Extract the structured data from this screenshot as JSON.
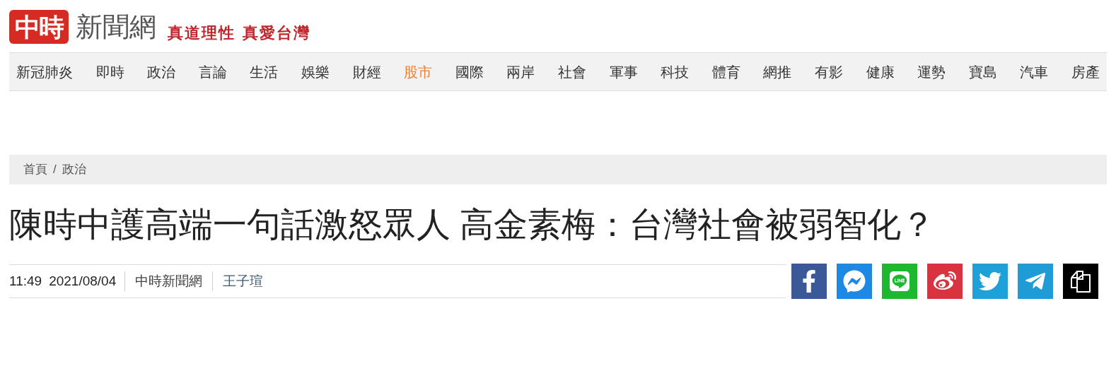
{
  "header": {
    "logo_mark": "中時",
    "logo_text": "新聞網",
    "slogan": "真道理性 真愛台灣"
  },
  "nav": [
    {
      "label": "新冠肺炎",
      "selected": false
    },
    {
      "label": "即時",
      "selected": false
    },
    {
      "label": "政治",
      "selected": false
    },
    {
      "label": "言論",
      "selected": false
    },
    {
      "label": "生活",
      "selected": false
    },
    {
      "label": "娛樂",
      "selected": false
    },
    {
      "label": "財經",
      "selected": false
    },
    {
      "label": "股市",
      "selected": true
    },
    {
      "label": "國際",
      "selected": false
    },
    {
      "label": "兩岸",
      "selected": false
    },
    {
      "label": "社會",
      "selected": false
    },
    {
      "label": "軍事",
      "selected": false
    },
    {
      "label": "科技",
      "selected": false
    },
    {
      "label": "體育",
      "selected": false
    },
    {
      "label": "網推",
      "selected": false
    },
    {
      "label": "有影",
      "selected": false
    },
    {
      "label": "健康",
      "selected": false
    },
    {
      "label": "運勢",
      "selected": false
    },
    {
      "label": "寶島",
      "selected": false
    },
    {
      "label": "汽車",
      "selected": false
    },
    {
      "label": "房產",
      "selected": false
    }
  ],
  "breadcrumb": [
    "首頁",
    "政治"
  ],
  "breadcrumb_separator": "/",
  "article": {
    "title": "陳時中護高端一句話激怒眾人 高金素梅：台灣社會被弱智化？",
    "time": "11:49",
    "date": "2021/08/04",
    "source": "中時新聞網",
    "author": "王子瑄"
  },
  "share": [
    {
      "kind": "facebook"
    },
    {
      "kind": "messenger"
    },
    {
      "kind": "line"
    },
    {
      "kind": "weibo"
    },
    {
      "kind": "twitter"
    },
    {
      "kind": "telegram"
    },
    {
      "kind": "copy"
    }
  ]
}
